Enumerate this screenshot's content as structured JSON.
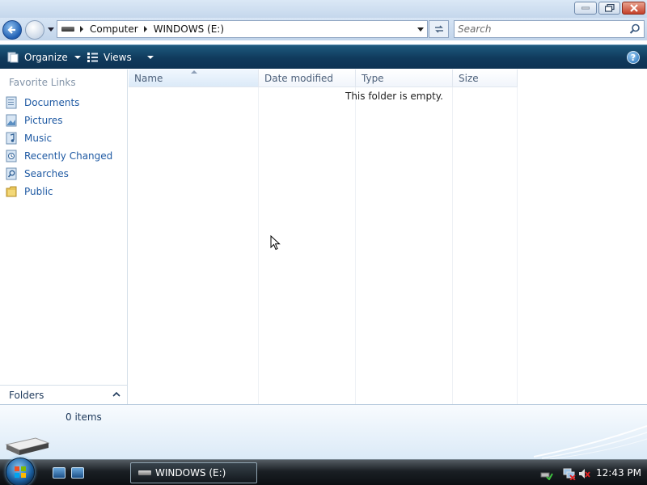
{
  "window": {
    "controls": [
      "minimize-icon",
      "maximize-icon",
      "close-icon"
    ]
  },
  "address": {
    "crumbs": [
      "Computer",
      "WINDOWS (E:)"
    ]
  },
  "search": {
    "placeholder": "Search"
  },
  "toolbar": {
    "organize_label": "Organize",
    "views_label": "Views",
    "help_label": "?"
  },
  "sidebar": {
    "title": "Favorite Links",
    "items": [
      {
        "label": "Documents",
        "icon": "documents-icon"
      },
      {
        "label": "Pictures",
        "icon": "pictures-icon"
      },
      {
        "label": "Music",
        "icon": "music-icon"
      },
      {
        "label": "Recently Changed",
        "icon": "recently-changed-icon"
      },
      {
        "label": "Searches",
        "icon": "searches-icon"
      },
      {
        "label": "Public",
        "icon": "public-folder-icon"
      }
    ],
    "folders_label": "Folders"
  },
  "content": {
    "columns": [
      "Name",
      "Date modified",
      "Type",
      "Size"
    ],
    "sorted_column": "Name",
    "empty_message": "This folder is empty."
  },
  "details": {
    "item_count": "0 items"
  },
  "taskbar": {
    "task_label": "WINDOWS (E:)",
    "clock": "12:43 PM"
  },
  "colors": {
    "toolbar": "#103a5c",
    "link": "#1f5aa3",
    "close_button": "#c4402a"
  }
}
